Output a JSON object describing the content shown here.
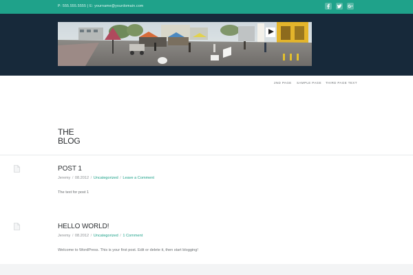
{
  "topbar": {
    "contact": "P: 555.555.5555 | E: yourname@yourdomain.com",
    "social": [
      "facebook-icon",
      "twitter-icon",
      "google-plus-icon"
    ],
    "color": "#1fa28a"
  },
  "hero": {
    "background": "#17293a",
    "image": "market-street-panorama"
  },
  "nav": {
    "items": [
      "2ND PAGE",
      "SAMPLE PAGE",
      "THIRD PAGE TEXT"
    ]
  },
  "blog": {
    "title_line1": "THE",
    "title_line2": "BLOG"
  },
  "posts": [
    {
      "title": "POST 1",
      "author": "Jeremy",
      "date": "08.2012",
      "category": "Uncategorized",
      "comments": "Leave a Comment",
      "body": "The text for post 1"
    },
    {
      "title": "HELLO WORLD!",
      "author": "Jeremy",
      "date": "08.2012",
      "category": "Uncategorized",
      "comments": "1 Comment",
      "body": "Welcome to WordPress. This is your first post. Edit or delete it, then start blogging!"
    }
  ],
  "meta_separator": "/",
  "accent": "#1fa28a"
}
